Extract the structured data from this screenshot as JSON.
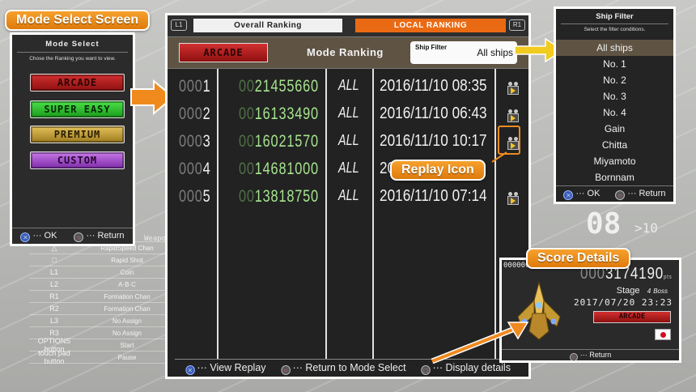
{
  "background": {
    "controls": [
      {
        "key": "✕",
        "action": "Shot"
      },
      {
        "key": "△",
        "action": "RapidSpeed Chan"
      },
      {
        "key": "□",
        "action": "Rapid Shot"
      },
      {
        "key": "L1",
        "action": "Coin"
      },
      {
        "key": "L2",
        "action": "A·B·C"
      },
      {
        "key": "R1",
        "action": "Formation Chan"
      },
      {
        "key": "R2",
        "action": "Formation Chan"
      },
      {
        "key": "L3",
        "action": "No Assign"
      },
      {
        "key": "R3",
        "action": "No Assign"
      },
      {
        "key": "OPTIONS button",
        "action": "Start"
      },
      {
        "key": "touch pad button",
        "action": "Pause"
      }
    ],
    "weapon_text": "Weapo",
    "counter": "08",
    "counter_sub": ">10"
  },
  "mode_select": {
    "callout": "Mode Select Screen",
    "title": "Mode Select",
    "subtitle": "Chose the Ranking you want to view.",
    "modes": [
      "ARCADE",
      "SUPER EASY",
      "PREMIUM",
      "CUSTOM"
    ],
    "ok_label": "··· OK",
    "return_label": "··· Return"
  },
  "ranking": {
    "tab_l1": "L1",
    "tab_r1": "R1",
    "tab_overall": "Overall Ranking",
    "tab_local": "LOCAL RANKING",
    "mode_badge": "ARCADE",
    "title": "Mode Ranking",
    "filter_label": "Ship Filter",
    "filter_value": "All ships",
    "rows": [
      {
        "rank_dim": "000",
        "rank": "1",
        "score_dim": "00",
        "score": "21455660",
        "ship": "ALL",
        "date": "2016/11/10 08:35",
        "replay": true
      },
      {
        "rank_dim": "000",
        "rank": "2",
        "score_dim": "00",
        "score": "16133490",
        "ship": "ALL",
        "date": "2016/11/10 06:43",
        "replay": true
      },
      {
        "rank_dim": "000",
        "rank": "3",
        "score_dim": "00",
        "score": "16021570",
        "ship": "ALL",
        "date": "2016/11/10 10:17",
        "replay": true
      },
      {
        "rank_dim": "000",
        "rank": "4",
        "score_dim": "00",
        "score": "14681000",
        "ship": "ALL",
        "date": "20",
        "replay": false
      },
      {
        "rank_dim": "000",
        "rank": "5",
        "score_dim": "00",
        "score": "13818750",
        "ship": "ALL",
        "date": "2016/11/10 07:14",
        "replay": true
      }
    ],
    "replay_callout": "Replay Icon",
    "footer": {
      "view_replay": "··· View Replay",
      "return_mode": "··· Return to Mode Select",
      "display_details": "··· Display details"
    }
  },
  "ship_filter": {
    "title": "Ship Filter",
    "subtitle": "Select the filter conditions.",
    "options": [
      "All ships",
      "No. 1",
      "No. 2",
      "No. 3",
      "No. 4",
      "Gain",
      "Chitta",
      "Miyamoto",
      "Bornnam"
    ],
    "selected_index": 0,
    "ok_label": "··· OK",
    "return_label": "··· Return"
  },
  "score_details": {
    "callout": "Score Details",
    "rank": "0000001",
    "score_dim": "000",
    "score": "3174190",
    "pts": "pts",
    "stage_label": "Stage",
    "stage_value": "4",
    "stage_suffix": "Boss",
    "date": "2017/07/20 23:23",
    "mode": "ARCADE",
    "return_label": "··· Return"
  },
  "colors": {
    "accent_orange": "#ea6a14",
    "score_green": "#a6e28f",
    "arrow_yellow": "#f1cb1f"
  }
}
